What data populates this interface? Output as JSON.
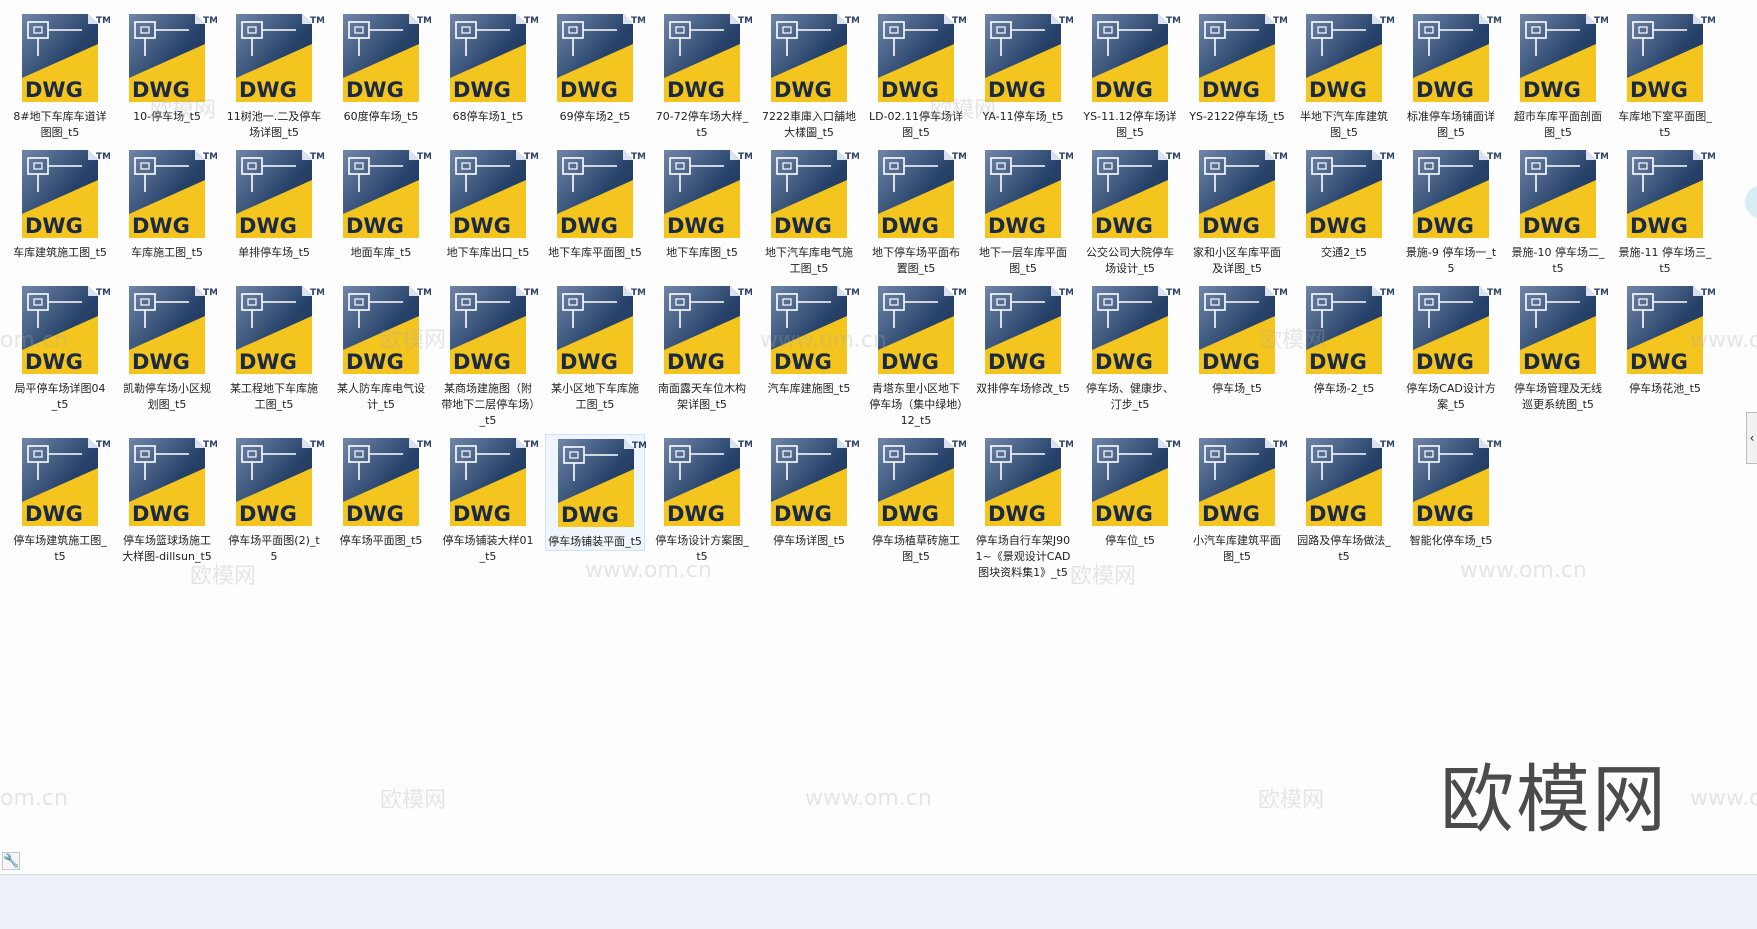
{
  "brand": {
    "dwg": "DWG",
    "tm": "TM"
  },
  "colors": {
    "file_yellow": "#f3c51e",
    "file_navy": "#27426a",
    "file_navy_light": "#6f86a8",
    "selection_bg": "#eef5fc"
  },
  "icon_name": "dwg-file-icon",
  "watermark": {
    "text_cn": "欧模网",
    "text_url": "www.om.cn",
    "text_partial": "om.cn",
    "logo": "欧模网"
  },
  "rows": [
    [
      "8#地下车库车道详图图_t5",
      "10-停车场_t5",
      "11树池一.二及停车场详图_t5",
      "60度停车场_t5",
      "68停车场1_t5",
      "69停车场2_t5",
      "70-72停车场大样_t5",
      "7222車庫入口舗地大樣圖_t5",
      "LD-02.11停车场详图_t5",
      "YA-11停车场_t5",
      "YS-11.12停车场详图_t5",
      "YS-2122停车场_t5",
      "半地下汽车库建筑图_t5",
      "标准停车场铺面详图_t5",
      "超市车库平面剖面图_t5",
      "车库地下室平面图_t5"
    ],
    [
      "车库建筑施工图_t5",
      "车库施工图_t5",
      "单排停车场_t5",
      "地面车库_t5",
      "地下车库出口_t5",
      "地下车库平面图_t5",
      "地下车库图_t5",
      "地下汽车库电气施工图_t5",
      "地下停车场平面布置图_t5",
      "地下一层车库平面图_t5",
      "公交公司大院停车场设计_t5",
      "家和小区车库平面及详图_t5",
      "交通2_t5",
      "景施-9 停车场一_t5",
      "景施-10 停车场二_t5",
      "景施-11 停车场三_t5"
    ],
    [
      "局平停车场详图04_t5",
      "凯勒停车场小区规划图_t5",
      "某工程地下车库施工图_t5",
      "某人防车库电气设计_t5",
      "某商场建施图（附带地下二层停车场）_t5",
      "某小区地下车库施工图_t5",
      "南面露天车位木构架详图_t5",
      "汽车库建施图_t5",
      "青塔东里小区地下停车场（集中绿地）12_t5",
      "双排停车场修改_t5",
      "停车场、健康步、汀步_t5",
      "停车场_t5",
      "停车场-2_t5",
      "停车场CAD设计方案_t5",
      "停车场管理及无线巡更系统图_t5",
      "停车场花池_t5"
    ],
    [
      "停车场建筑施工图_t5",
      "停车场篮球场施工大样图-dillsun_t5",
      "停车场平面图(2)_t5",
      "停车场平面图_t5",
      "停车场铺装大样01_t5",
      "停车场铺装平面_t5",
      "停车场设计方案图_t5",
      "停车场详图_t5",
      "停车场植草砖施工图_t5",
      "停车场自行车架J901~《景观设计CAD图块资料集1》_t5",
      "停车位_t5",
      "小汽车库建筑平面图_t5",
      "园路及停车场做法_t5",
      "智能化停车场_t5"
    ]
  ],
  "selected": {
    "row": 3,
    "col": 5
  }
}
